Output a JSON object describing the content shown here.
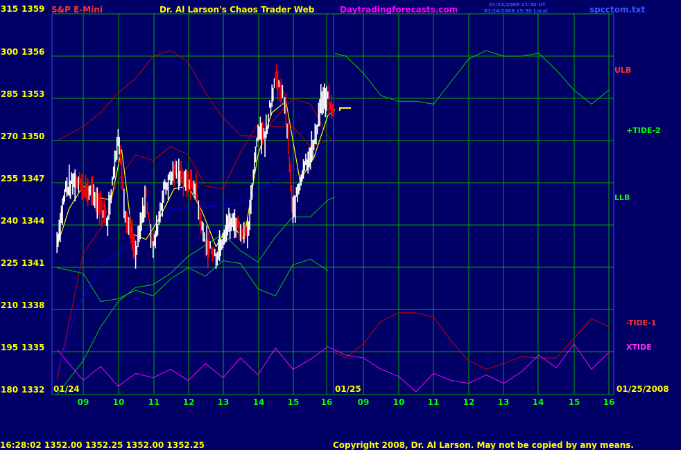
{
  "header": {
    "symbol_title": "S&P E-Mini",
    "site_title": "Dr. Al Larson's Chaos Trader Web",
    "site_url": "Daytradingforecasts.com",
    "timestamp_1": "01/24/2008 21:30 UT",
    "timestamp_2": "01/24/2008 15:30 Local",
    "file_name": "spcctom.txt"
  },
  "footer": {
    "quote": "16:28:02  1352.00  1352.25  1352.00  1352.25",
    "copyright": "Copyright 2008, Dr. Al Larson. May not be copied by any means."
  },
  "colors": {
    "background": "#000066",
    "grid": "#00AA00",
    "price_bars": "#FFFFFF",
    "down_bars": "#FF0000",
    "yellow": "#FFFF00",
    "green": "#00CC00",
    "red": "#CC0000",
    "blue": "#0000FF",
    "magenta": "#FF00FF",
    "title_red": "#FF3333",
    "site_magenta": "#FF00FF"
  },
  "chart_data": {
    "type": "line",
    "title": "S&P E-Mini",
    "y_left_labels": [
      "315",
      "300",
      "285",
      "270",
      "255",
      "240",
      "225",
      "210",
      "195",
      "180"
    ],
    "y_right_labels": [
      "1359",
      "1356",
      "1353",
      "1350",
      "1347",
      "1344",
      "1341",
      "1338",
      "1335",
      "1332"
    ],
    "ylim_price": [
      1332,
      1359
    ],
    "ylim_index": [
      180,
      315
    ],
    "x_tick_labels": [
      "09",
      "10",
      "11",
      "12",
      "13",
      "14",
      "15",
      "16",
      "01/25",
      "09",
      "10",
      "11",
      "12",
      "13",
      "14",
      "15",
      "16"
    ],
    "date_labels": [
      "01/24",
      "01/25",
      "01/25/2008"
    ],
    "right_labels": [
      {
        "text": "ULB",
        "color": "#FF3333"
      },
      {
        "text": "+TIDE-2",
        "color": "#00FF00"
      },
      {
        "text": "LLB",
        "color": "#00FF00"
      },
      {
        "text": "-TIDE-1",
        "color": "#FF3333"
      },
      {
        "text": "XTIDE",
        "color": "#FF33FF"
      }
    ],
    "x_hours": [
      8.25,
      16.2,
      8.2,
      16.1
    ],
    "series": [
      {
        "name": "+TIDE-2",
        "color": "#00CC00",
        "x": [
          16.2,
          16.5,
          17.0,
          17.5,
          18.0,
          18.5,
          19.0,
          19.5,
          20.0,
          20.5,
          21.0,
          21.5,
          22.0,
          22.5,
          23.0,
          23.5,
          24.0
        ],
        "y": [
          1356.2,
          1356.0,
          1354.8,
          1353.2,
          1352.8,
          1352.8,
          1352.6,
          1354.2,
          1355.8,
          1356.4,
          1356.0,
          1356.0,
          1356.2,
          1355.0,
          1353.6,
          1352.6,
          1353.6
        ]
      },
      {
        "name": "-TIDE-1",
        "color": "#CC0000",
        "x": [
          16.2,
          16.5,
          17.0,
          17.5,
          18.0,
          18.5,
          19.0,
          19.5,
          20.0,
          20.5,
          21.0,
          21.5,
          22.0,
          22.5,
          23.0,
          23.5,
          24.0
        ],
        "y": [
          1335.0,
          1334.6,
          1335.6,
          1337.2,
          1337.8,
          1337.8,
          1337.5,
          1335.8,
          1334.4,
          1333.8,
          1334.2,
          1334.7,
          1334.6,
          1334.6,
          1336.0,
          1337.4,
          1336.8
        ]
      },
      {
        "name": "XTIDE",
        "color": "#FF00FF",
        "x": [
          8.25,
          9.0,
          9.5,
          10.0,
          10.5,
          11.0,
          11.5,
          12.0,
          12.5,
          13.0,
          13.5,
          14.0,
          14.5,
          15.0,
          15.5,
          16.0,
          16.5,
          17.0,
          17.5,
          18.0,
          18.5,
          19.0,
          19.5,
          20.0,
          20.5,
          21.0,
          21.5,
          22.0,
          22.5,
          23.0,
          23.5,
          24.0
        ],
        "y": [
          1335.2,
          1333.0,
          1334.0,
          1332.6,
          1333.5,
          1333.2,
          1333.8,
          1333.0,
          1334.2,
          1333.2,
          1334.6,
          1333.4,
          1335.3,
          1333.8,
          1334.5,
          1335.4,
          1334.8,
          1334.6,
          1333.8,
          1333.3,
          1332.2,
          1333.5,
          1333.0,
          1332.8,
          1333.4,
          1332.8,
          1333.6,
          1334.8,
          1333.9,
          1335.6,
          1333.8,
          1335.0
        ]
      },
      {
        "name": "ULB",
        "color": "#CC0000",
        "x": [
          8.25,
          9.0,
          9.5,
          10.0,
          10.5,
          11.0,
          11.5,
          12.0,
          12.5,
          13.0,
          13.5,
          14.0,
          14.5,
          15.0,
          15.5,
          16.0,
          16.2
        ],
        "y": [
          1350.0,
          1351.0,
          1352.0,
          1353.4,
          1354.4,
          1356.0,
          1356.4,
          1355.6,
          1353.4,
          1351.6,
          1350.4,
          1350.3,
          1351.6,
          1353.0,
          1352.6,
          1350.4,
          1349.8
        ]
      },
      {
        "name": "LLB",
        "color": "#00CC00",
        "x": [
          8.25,
          9.0,
          9.5,
          10.0,
          10.5,
          11.0,
          11.5,
          12.0,
          12.5,
          13.0,
          13.5,
          14.0,
          14.5,
          15.0,
          15.5,
          16.0,
          16.2
        ],
        "y": [
          1332.0,
          1334.4,
          1336.8,
          1338.6,
          1339.6,
          1339.8,
          1340.6,
          1341.8,
          1342.6,
          1343.4,
          1342.2,
          1341.4,
          1343.2,
          1344.6,
          1344.6,
          1345.8,
          1346.0
        ]
      },
      {
        "name": "band-3",
        "color": "#00CC00",
        "x": [
          8.25,
          9.0,
          9.5,
          10.0,
          10.5,
          11.0,
          11.5,
          12.0,
          12.5,
          13.0,
          13.5,
          14.0,
          14.5,
          15.0,
          15.5,
          16.0
        ],
        "y": [
          1341.0,
          1340.6,
          1338.6,
          1338.8,
          1339.4,
          1339.0,
          1340.2,
          1341.0,
          1340.4,
          1341.5,
          1341.3,
          1339.5,
          1339.0,
          1341.2,
          1341.6,
          1340.8
        ]
      },
      {
        "name": "band-4",
        "color": "#CC0000",
        "x": [
          8.25,
          9.0,
          9.5,
          10.0,
          10.5,
          11.0,
          11.5,
          12.0,
          12.5,
          13.0,
          13.5,
          14.0,
          14.5,
          15.0,
          15.5,
          16.0
        ],
        "y": [
          1333.0,
          1342.0,
          1343.8,
          1347.2,
          1349.0,
          1348.6,
          1349.6,
          1349.0,
          1346.8,
          1346.6,
          1349.2,
          1351.2,
          1351.0,
          1351.0,
          1349.6,
          1350.0
        ]
      },
      {
        "name": "trend",
        "color": "#0000FF",
        "x": [
          8.25,
          8.8,
          9.5,
          10.5,
          11.5,
          12.5,
          13.5,
          14.5,
          15.5,
          16.2
        ],
        "y": [
          1333.5,
          1338.0,
          1341.2,
          1343.0,
          1345.2,
          1345.3,
          1345.6,
          1347.2,
          1348.6,
          1350.2
        ]
      },
      {
        "name": "price",
        "color": "#FFFFFF",
        "x": [
          8.25,
          8.5,
          8.8,
          9.1,
          9.4,
          9.7,
          10.0,
          10.2,
          10.5,
          10.8,
          11.0,
          11.3,
          11.6,
          11.9,
          12.2,
          12.5,
          12.8,
          13.1,
          13.4,
          13.7,
          14.0,
          14.2,
          14.5,
          14.8,
          15.0,
          15.3,
          15.6,
          15.8,
          16.0,
          16.2
        ],
        "y": [
          1342.8,
          1346.6,
          1347.2,
          1346.5,
          1345.8,
          1344.4,
          1350.6,
          1345.0,
          1341.8,
          1346.2,
          1342.2,
          1346.4,
          1347.8,
          1347.2,
          1346.8,
          1342.6,
          1341.8,
          1344.0,
          1344.2,
          1343.2,
          1350.6,
          1350.2,
          1354.6,
          1352.4,
          1344.8,
          1348.2,
          1349.6,
          1352.8,
          1352.8,
          1352.4
        ]
      },
      {
        "name": "yellow-ma",
        "color": "#FFFF00",
        "x": [
          8.25,
          8.6,
          9.0,
          9.4,
          9.8,
          10.1,
          10.4,
          10.8,
          11.2,
          11.6,
          12.0,
          12.4,
          12.8,
          13.2,
          13.6,
          14.0,
          14.4,
          14.8,
          15.2,
          15.6,
          16.0,
          16.2
        ],
        "y": [
          1342.5,
          1345.2,
          1346.8,
          1346.0,
          1345.8,
          1349.4,
          1343.4,
          1343.0,
          1344.6,
          1346.6,
          1346.8,
          1345.0,
          1342.5,
          1344.2,
          1343.0,
          1349.0,
          1352.0,
          1352.8,
          1347.2,
          1348.8,
          1351.8,
          1352.2
        ]
      }
    ]
  }
}
